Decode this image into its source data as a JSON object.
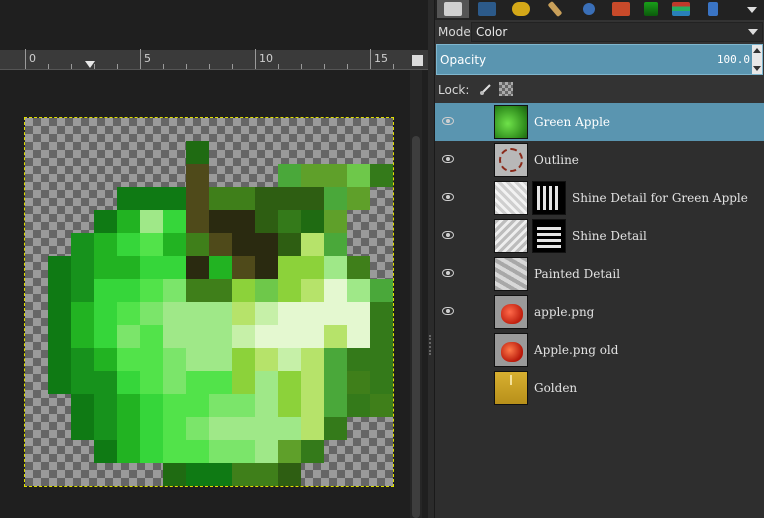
{
  "ruler": {
    "labels": [
      "0",
      "5",
      "10",
      "15"
    ]
  },
  "dock": {
    "tool_tabs": [
      "layers-icon",
      "paths-icon",
      "undo-icon",
      "brush-icon",
      "search-icon",
      "fonts-icon",
      "gradient-icon",
      "books-icon",
      "palette-brush-icon"
    ],
    "mode_label": "Mode:",
    "mode_value": "Color",
    "opacity_label": "Opacity",
    "opacity_value": "100.0",
    "lock_label": "Lock:"
  },
  "layers": [
    {
      "name": "Green Apple",
      "visible": true,
      "selected": true,
      "thumb": "green-apple-thumb"
    },
    {
      "name": "Outline",
      "visible": true,
      "selected": false,
      "thumb": "outline-thumb"
    },
    {
      "name": "Shine Detail for Green Apple",
      "visible": true,
      "selected": false,
      "thumb": "shine-thumb",
      "has_mask": true
    },
    {
      "name": "Shine Detail",
      "visible": true,
      "selected": false,
      "thumb": "shine-thumb",
      "has_mask": true
    },
    {
      "name": "Painted Detail",
      "visible": true,
      "selected": false,
      "thumb": "painted-thumb"
    },
    {
      "name": "apple.png",
      "visible": true,
      "selected": false,
      "thumb": "apple-thumb"
    },
    {
      "name": "Apple.png old",
      "visible": false,
      "selected": false,
      "thumb": "apple-old-thumb"
    },
    {
      "name": "Golden",
      "visible": false,
      "selected": false,
      "thumb": "golden-thumb"
    }
  ],
  "colors": {
    "selection": "#5a95b0",
    "apple_green": "#4cc42a",
    "golden": "#c9a227"
  }
}
